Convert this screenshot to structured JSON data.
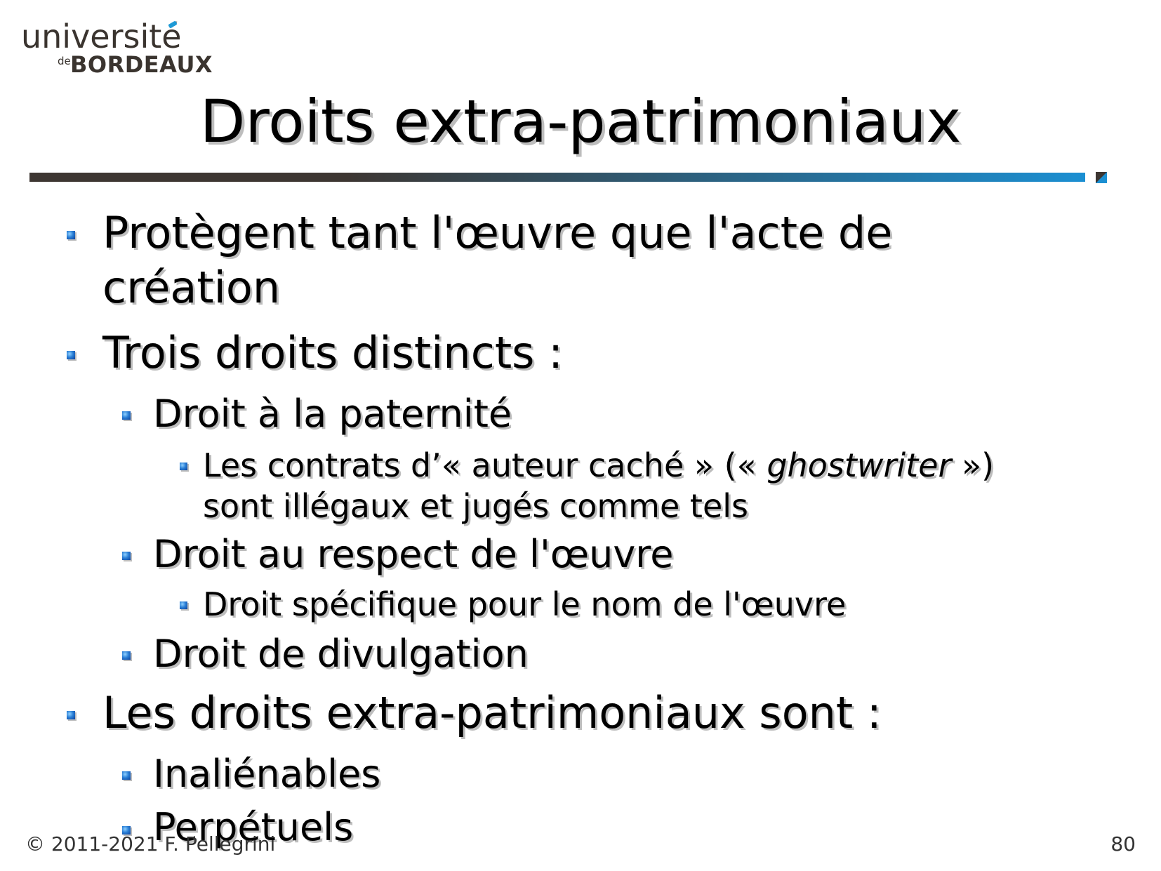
{
  "logo": {
    "line1": "université",
    "small": "de",
    "line2": "BORDEAUX"
  },
  "slide": {
    "title": "Droits extra-patrimoniaux",
    "items": [
      {
        "level": 1,
        "text_line1": "Protègent tant l'œuvre que l'acte de",
        "text_line2": "création"
      },
      {
        "level": 1,
        "text": "Trois droits distincts :"
      },
      {
        "level": 2,
        "text": "Droit à la paternité"
      },
      {
        "level": 3,
        "text_a": "Les contrats d’« auteur caché » (« ",
        "text_italic": "ghostwriter",
        "text_b": " »)",
        "text_line2": "sont illégaux et jugés comme tels"
      },
      {
        "level": 2,
        "text": "Droit au respect de l'œuvre"
      },
      {
        "level": 3,
        "text": "Droit spécifique pour le nom de l'œuvre"
      },
      {
        "level": 2,
        "text": "Droit de divulgation"
      },
      {
        "level": 1,
        "text": "Les droits extra-patrimoniaux sont :"
      },
      {
        "level": 2,
        "text": "Inaliénables"
      },
      {
        "level": 2,
        "text": "Perpétuels"
      }
    ]
  },
  "footer": {
    "copyright": "© 2011-2021 F. Pellegrini",
    "page_number": "80"
  },
  "colors": {
    "rule_dark": "#3d3632",
    "rule_blue": "#1b8fd2",
    "bullet_blue": "#2a7fd6"
  }
}
